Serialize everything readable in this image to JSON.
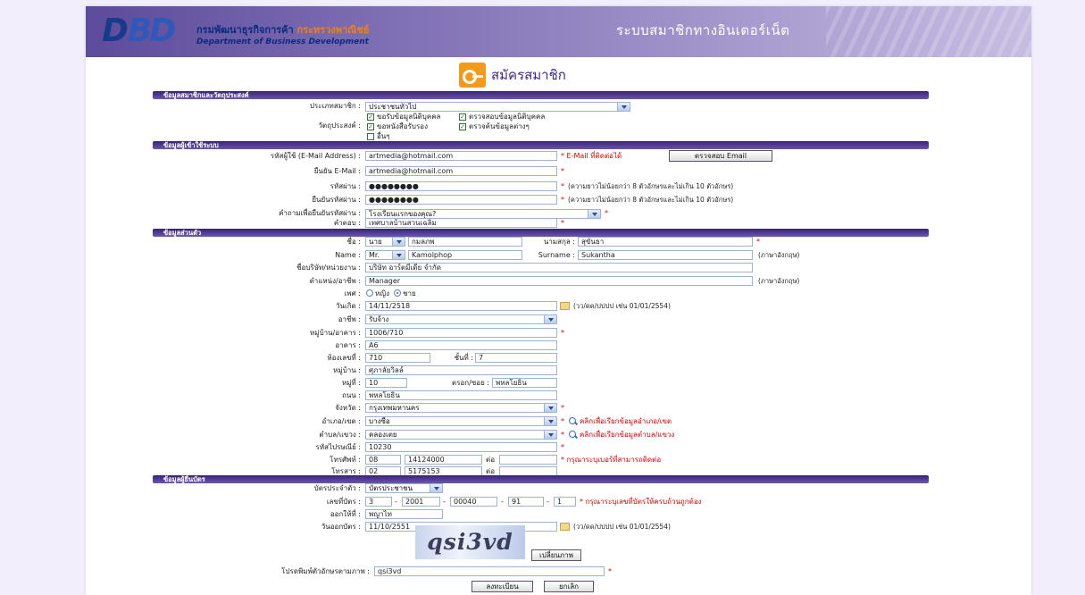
{
  "header": {
    "logo_text_1": "D",
    "logo_text_2": "BD",
    "dept_th": "กรมพัฒนาธุรกิจการค้า",
    "ministry_th": "กระทรวงพาณิชย์",
    "dept_en": "Department of Business Development",
    "system_title": "ระบบสมาชิกทางอินเตอร์เน็ต",
    "accent": "#5d4b9b"
  },
  "title": "สมัครสมาชิก",
  "sections": {
    "s1": "ข้อมูลสมาชิกและวัตถุประสงค์",
    "s2": "ข้อมูลผู้เข้าใช้ระบบ",
    "s3": "ข้อมูลส่วนตัว",
    "s4": "ข้อมูลผู้ยื่นบัตร"
  },
  "member": {
    "type_label": "ประเภทสมาชิก :",
    "type_value": "ประชาชนทั่วไป",
    "purpose_label": "วัตถุประสงค์ :",
    "purposes": [
      "ขอรับข้อมูลนิติบุคคล",
      "ตรวจสอบข้อมูลนิติบุคคล",
      "ขอหนังสือรับรอง",
      "ตรวจค้นข้อมูลต่างๆ",
      "อื่นๆ"
    ]
  },
  "login": {
    "user_label": "รหัสผู้ใช้ (E-Mail Address) :",
    "user_value": "artmedia@hotmail.com",
    "user_note": "* E-Mail ที่ติดต่อได้",
    "check_email_button": "ตรวจสอบ Email",
    "confirm_email_label": "ยืนยัน E-Mail :",
    "confirm_email_value": "artmedia@hotmail.com",
    "password_label": "รหัสผ่าน :",
    "password_value": "●●●●●●●●",
    "password_note": "(ความยาวไม่น้อยกว่า 8 ตัวอักษรและไม่เกิน 10 ตัวอักษร)",
    "confirm_password_label": "ยืนยันรหัสผ่าน :",
    "confirm_password_value": "●●●●●●●●",
    "confirm_password_note": "(ความยาวไม่น้อยกว่า 8 ตัวอักษรและไม่เกิน 10 ตัวอักษร)",
    "question_label": "คำถามเพื่อยืนยันรหัสผ่าน :",
    "question_value": "โรงเรียนแรกของคุณ?",
    "answer_label": "คำตอบ :",
    "answer_value": "เทศบาลบ้านสวนเฉลิม"
  },
  "personal": {
    "name_th_label": "ชื่อ :",
    "prefix_th": "นาย",
    "firstname_th": "กมลภพ",
    "lastname_th_label": "นามสกุล :",
    "lastname_th": "สุขันธา",
    "name_en_label": "Name :",
    "prefix_en": "Mr.",
    "firstname_en": "Kamolphop",
    "lastname_en_label": "Surname :",
    "lastname_en": "Sukantha",
    "english_note": "(ภาษาอังกฤษ)",
    "company_label": "ชื่อบริษัท/หน่วยงาน :",
    "company_value": "บริษัท อาร์ตมีเดีย จำกัด",
    "position_label": "ตำแหน่ง/อาชีพ :",
    "position_value": "Manager",
    "gender_label": "เพศ :",
    "gender_male": "หญิง",
    "gender_female": "ชาย",
    "birth_label": "วันเกิด :",
    "birth_value": "14/11/2518",
    "birth_note": "(วว/ดด/ปปปป เช่น 01/01/2554)",
    "occupation_label": "อาชีพ :",
    "occupation_value": "รับจ้าง",
    "address_label": "หมู่บ้าน/อาคาร :",
    "address_value": "1006/710",
    "building_label": "อาคาร :",
    "building_value": "A6",
    "room_label": "ห้องเลขที่ :",
    "room_value": "710",
    "floor_label": "ชั้นที่ :",
    "floor_value": "7",
    "village_label": "หมู่บ้าน :",
    "village_value": "ศุภาลัยวิลล์",
    "moo_label": "หมู่ที่ :",
    "moo_value": "10",
    "soi_label": "ตรอก/ซอย :",
    "soi_value": "พหลโยธิน",
    "road_label": "ถนน :",
    "road_value": "พหลโยธิน",
    "province_label": "จังหวัด :",
    "province_value": "กรุงเทพมหานคร",
    "district_label": "อำเภอ/เขต :",
    "district_value": "บางซื่อ",
    "district_link": "คลิกเพื่อเรียกข้อมูลอำเภอ/เขต",
    "subdistrict_label": "ตำบล/แขวง :",
    "subdistrict_value": "คลองเตย",
    "subdistrict_link": "คลิกเพื่อเรียกข้อมูลตำบล/แขวง",
    "postcode_label": "รหัสไปรษณีย์ :",
    "postcode_value": "10230",
    "phone_label": "โทรศัพท์ :",
    "phone_area": "08",
    "phone_number": "14124000",
    "ext_label": "ต่อ",
    "phone_note": "* กรุณาระบุเบอร์ที่สามารถติดต่อ",
    "fax_label": "โทรสาร :",
    "fax_area": "02",
    "fax_number": "5175153",
    "fax_ext_label": "ต่อ"
  },
  "card": {
    "type_label": "บัตรประจำตัว :",
    "type_value": "บัตรประชาชน",
    "number_label": "เลขที่บัตร :",
    "parts": [
      "3",
      "2001",
      "00040",
      "91",
      "1"
    ],
    "number_note": "* กรุณาระบุเลขที่บัตรให้ครบถ้วนถูกต้อง",
    "issued_by_label": "ออกให้ที่ :",
    "issued_by_value": "พญาไท",
    "issue_date_label": "วันออกบัตร :",
    "issue_date_value": "11/10/2551",
    "date_note": "(วว/ดด/ปปปป เช่น 01/01/2554)"
  },
  "captcha": {
    "text": "qsi3vd",
    "refresh_button": "เปลี่ยนภาพ",
    "label": "โปรดพิมพ์ตัวอักษรตามภาพ :",
    "value": "qsi3vd"
  },
  "actions": {
    "submit": "ลงทะเบียน",
    "cancel": "ยกเลิก"
  }
}
